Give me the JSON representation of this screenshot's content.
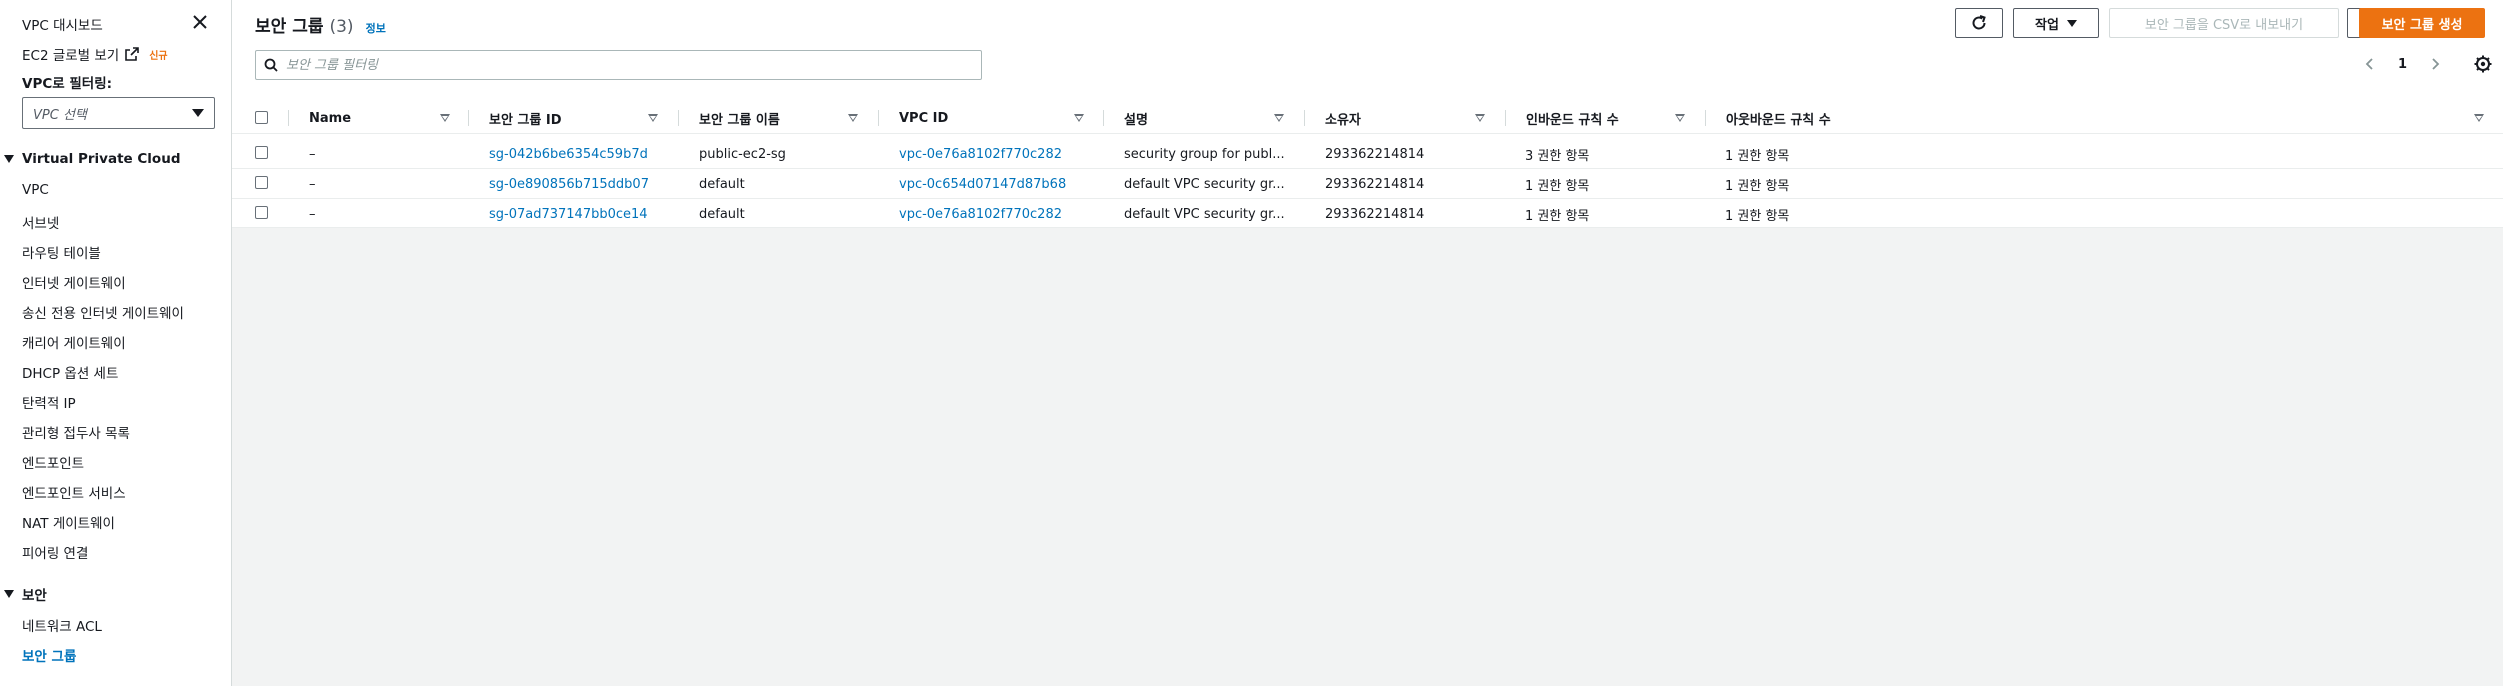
{
  "sidebar": {
    "title": "VPC 대시보드",
    "ec2_global": "EC2 글로벌 보기",
    "new_badge": "신규",
    "filter_label": "VPC로 필터링:",
    "vpc_select_placeholder": "VPC 선택",
    "section_vpc": "Virtual Private Cloud",
    "vpc_items": [
      {
        "label": "VPC"
      },
      {
        "label": "서브넷"
      },
      {
        "label": "라우팅 테이블"
      },
      {
        "label": "인터넷 게이트웨이"
      },
      {
        "label": "송신 전용 인터넷 게이트웨이"
      },
      {
        "label": "캐리어 게이트웨이"
      },
      {
        "label": "DHCP 옵션 세트"
      },
      {
        "label": "탄력적 IP"
      },
      {
        "label": "관리형 접두사 목록"
      },
      {
        "label": "엔드포인트"
      },
      {
        "label": "엔드포인트 서비스"
      },
      {
        "label": "NAT 게이트웨이"
      },
      {
        "label": "피어링 연결"
      }
    ],
    "section_security": "보안",
    "security_items": [
      {
        "label": "네트워크 ACL"
      },
      {
        "label": "보안 그룹"
      }
    ]
  },
  "header": {
    "title": "보안 그룹",
    "count": "(3)",
    "info": "정보",
    "actions_label": "작업",
    "export_label": "보안 그룹을 CSV로 내보내기",
    "create_label": "보안 그룹 생성"
  },
  "search": {
    "placeholder": "보안 그룹 필터링"
  },
  "pagination": {
    "current_page": "1"
  },
  "table": {
    "columns": [
      "Name",
      "보안 그룹 ID",
      "보안 그룹 이름",
      "VPC ID",
      "설명",
      "소유자",
      "인바운드 규칙 수",
      "아웃바운드 규칙 수"
    ],
    "rows": [
      {
        "name": "–",
        "sg_id": "sg-042b6be6354c59b7d",
        "sg_name": "public-ec2-sg",
        "vpc_id": "vpc-0e76a8102f770c282",
        "description": "security group for publ...",
        "owner": "293362214814",
        "inbound": "3 권한 항목",
        "outbound": "1 권한 항목"
      },
      {
        "name": "–",
        "sg_id": "sg-0e890856b715ddb07",
        "sg_name": "default",
        "vpc_id": "vpc-0c654d07147d87b68",
        "description": "default VPC security gr...",
        "owner": "293362214814",
        "inbound": "1 권한 항목",
        "outbound": "1 권한 항목"
      },
      {
        "name": "–",
        "sg_id": "sg-07ad737147bb0ce14",
        "sg_name": "default",
        "vpc_id": "vpc-0e76a8102f770c282",
        "description": "default VPC security gr...",
        "owner": "293362214814",
        "inbound": "1 권한 항목",
        "outbound": "1 권한 항목"
      }
    ]
  },
  "colors": {
    "accent_link": "#0073bb",
    "primary_button": "#ec7211",
    "new_badge": "#ec7211"
  }
}
